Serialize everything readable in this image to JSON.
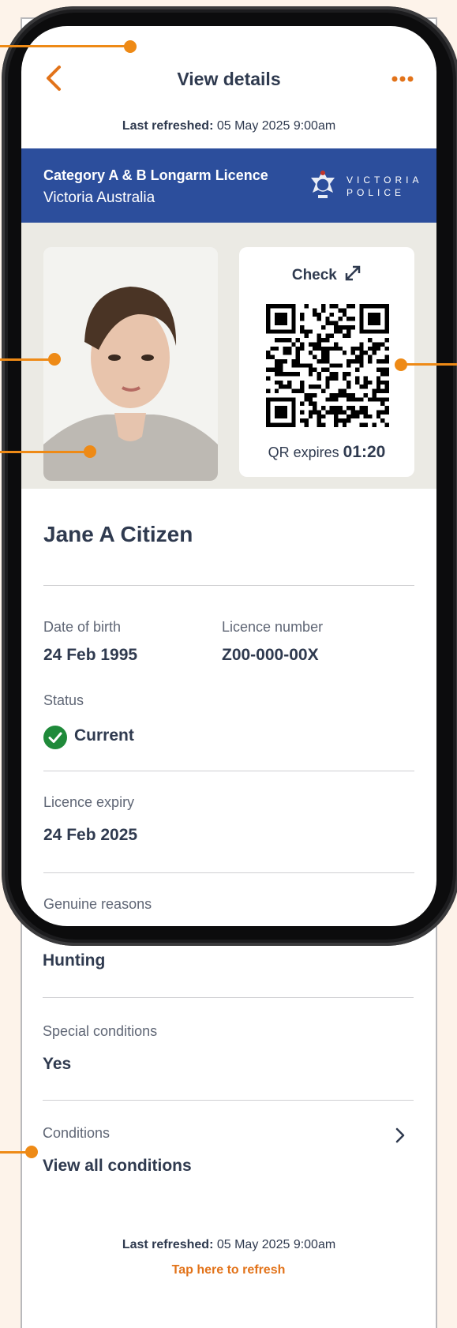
{
  "header": {
    "title": "View details",
    "refreshed_label": "Last refreshed:",
    "refreshed_value": "05 May 2025 9:00am"
  },
  "banner": {
    "title": "Category A & B Longarm Licence",
    "subtitle": "Victoria Australia",
    "logo_line1": "VICTORIA",
    "logo_line2": "POLICE"
  },
  "qr": {
    "check_label": "Check",
    "expires_label": "QR expires",
    "expires_value": "01:20"
  },
  "holder": {
    "name": "Jane A Citizen"
  },
  "details": {
    "dob_label": "Date of birth",
    "dob_value": "24 Feb 1995",
    "licence_label": "Licence number",
    "licence_value": "Z00-000-00X",
    "status_label": "Status",
    "status_value": "Current",
    "expiry_label": "Licence expiry",
    "expiry_value": "24 Feb 2025",
    "reasons_label": "Genuine reasons",
    "reasons_value": "Hunting",
    "special_label": "Special conditions",
    "special_value": "Yes",
    "conditions_label": "Conditions",
    "conditions_link": "View all conditions"
  },
  "footer": {
    "refreshed_label": "Last refreshed:",
    "refreshed_value": "05 May 2025 9:00am",
    "refresh_link": "Tap here to refresh"
  },
  "colors": {
    "accent": "#ee8a16",
    "banner": "#2c4e9c",
    "status": "#1f8a3a",
    "text": "#2f3a4f",
    "background": "#fdf3ea"
  },
  "icons": {
    "back": "chevron-left-icon",
    "more": "more-dots-icon",
    "expand": "expand-icon",
    "status": "check-circle-icon",
    "conditions": "chevron-right-icon"
  }
}
